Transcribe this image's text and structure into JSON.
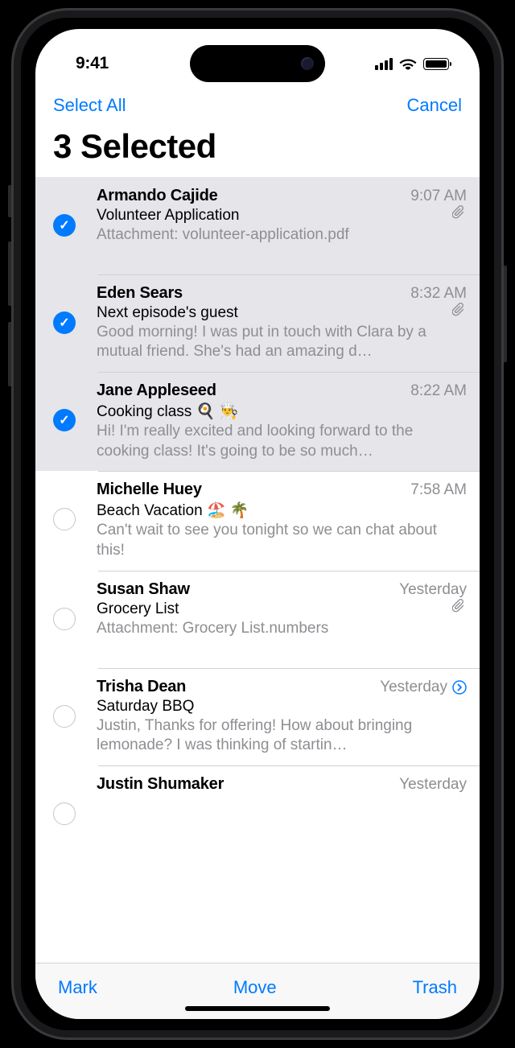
{
  "status": {
    "time": "9:41"
  },
  "nav": {
    "left": "Select All",
    "right": "Cancel"
  },
  "title": "3 Selected",
  "messages": [
    {
      "sender": "Armando Cajide",
      "time": "9:07 AM",
      "subject": "Volunteer Application",
      "preview": "Attachment: volunteer-application.pdf",
      "selected": true,
      "attachment": true,
      "single_line_preview": true
    },
    {
      "sender": "Eden Sears",
      "time": "8:32 AM",
      "subject": "Next episode's guest",
      "preview": "Good morning! I was put in touch with Clara by a mutual friend. She's had an amazing d…",
      "selected": true,
      "attachment": true
    },
    {
      "sender": "Jane Appleseed",
      "time": "8:22 AM",
      "subject": "Cooking class 🍳 👨‍🍳",
      "preview": "Hi! I'm really excited and looking forward to the cooking class! It's going to be so much…",
      "selected": true
    },
    {
      "sender": "Michelle Huey",
      "time": "7:58 AM",
      "subject": "Beach Vacation 🏖️ 🌴",
      "preview": "Can't wait to see you tonight so we can chat about this!",
      "selected": false
    },
    {
      "sender": "Susan Shaw",
      "time": "Yesterday",
      "subject": "Grocery List",
      "preview": "Attachment: Grocery List.numbers",
      "selected": false,
      "attachment": true,
      "single_line_preview": true
    },
    {
      "sender": "Trisha Dean",
      "time": "Yesterday",
      "subject": "Saturday BBQ",
      "preview": "Justin, Thanks for offering! How about bringing lemonade? I was thinking of startin…",
      "selected": false,
      "disclosure": true
    },
    {
      "sender": "Justin Shumaker",
      "time": "Yesterday",
      "subject": "",
      "preview": "",
      "selected": false,
      "partial": true
    }
  ],
  "toolbar": {
    "mark": "Mark",
    "move": "Move",
    "trash": "Trash"
  }
}
